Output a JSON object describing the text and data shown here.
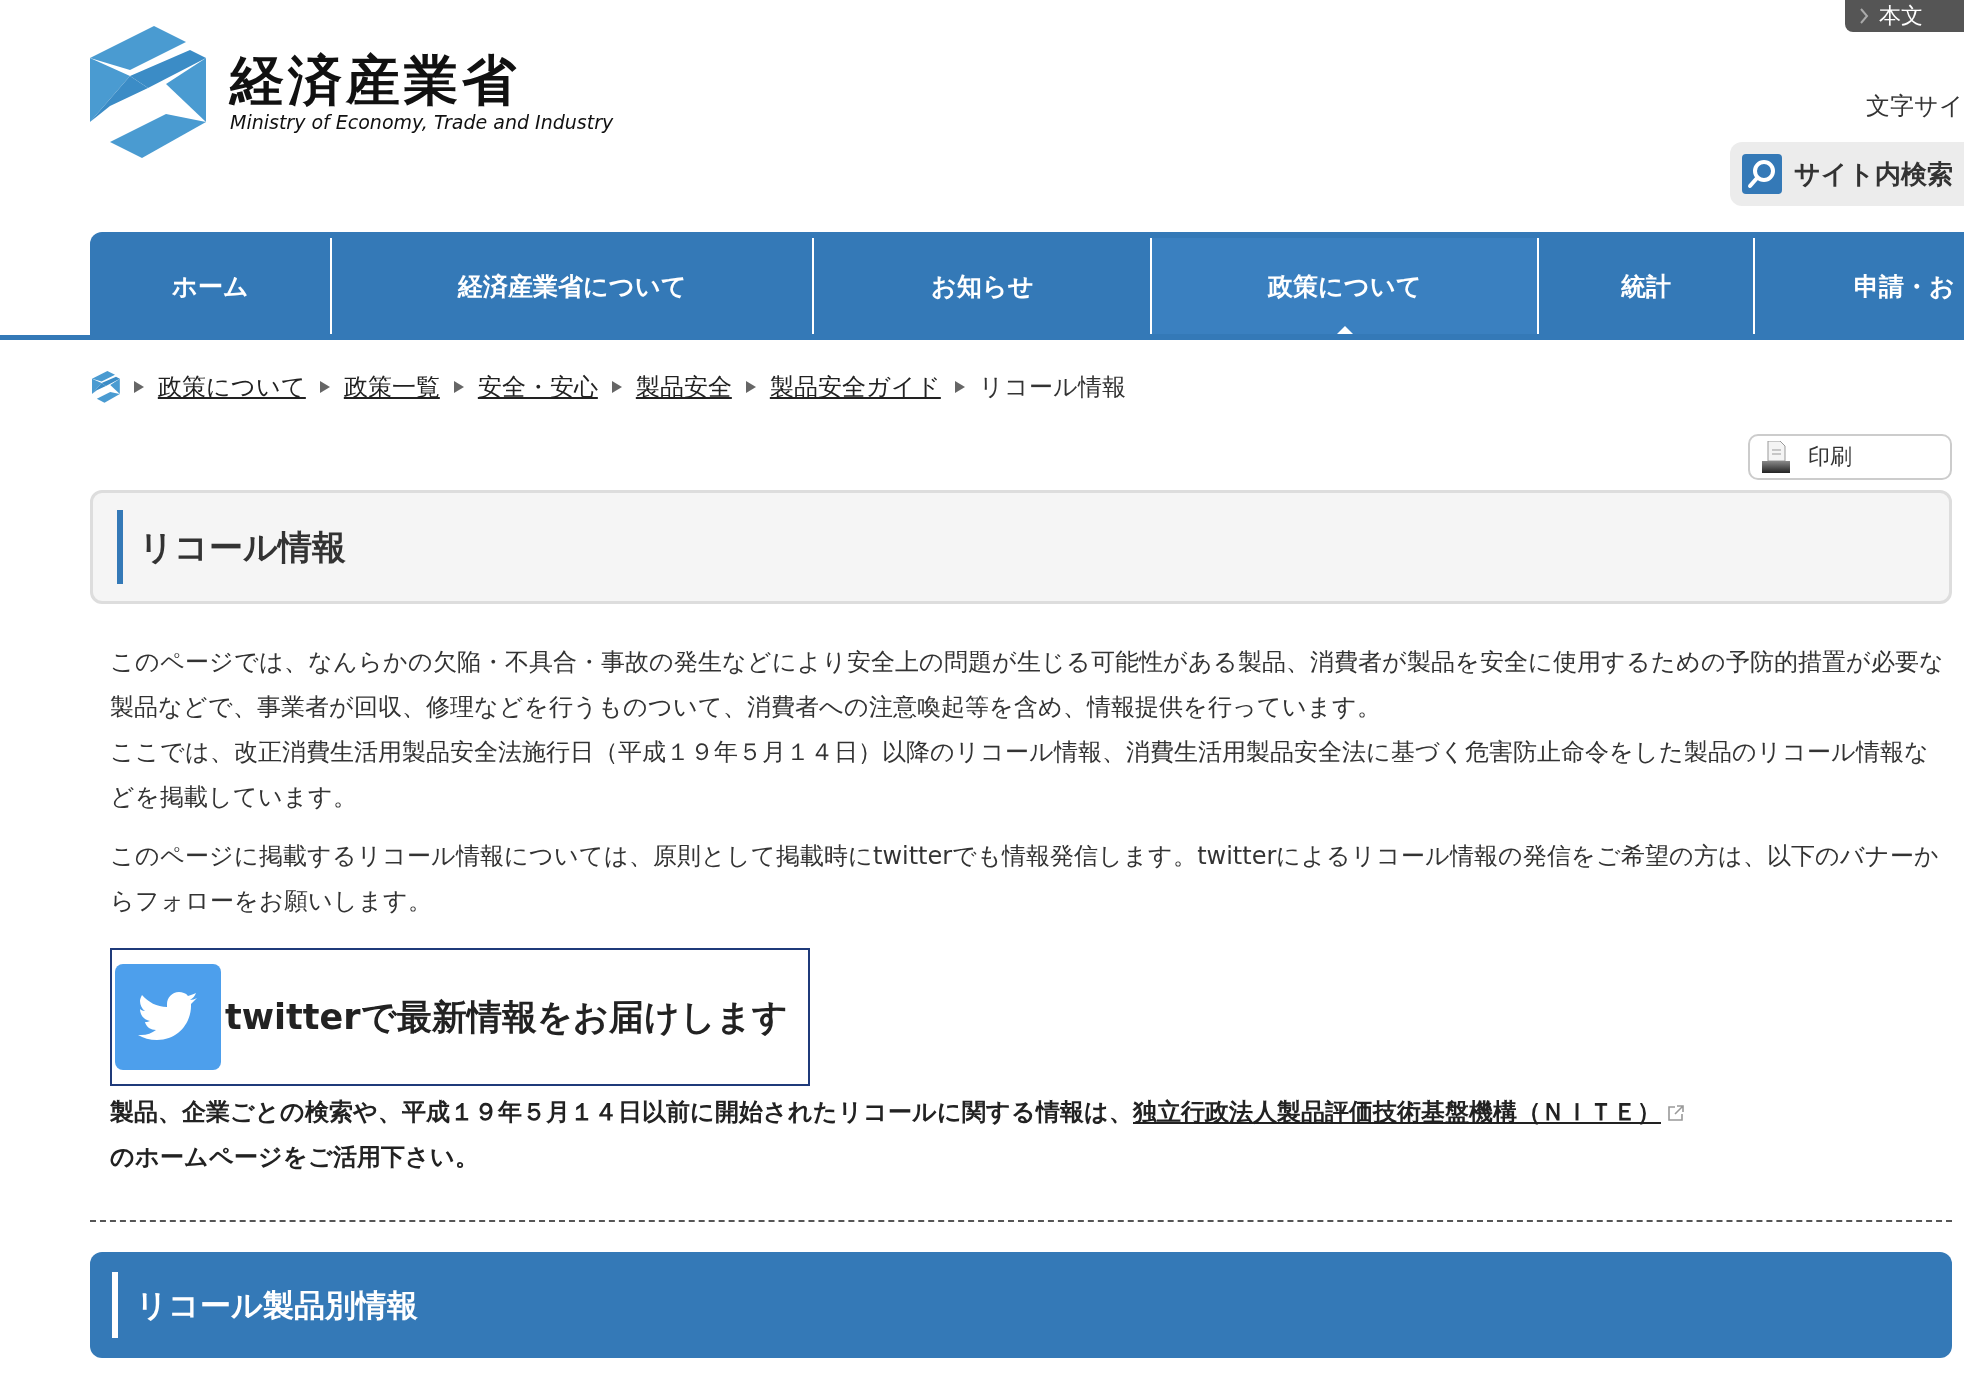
{
  "header": {
    "logo_title": "経済産業省",
    "logo_subtitle": "Ministry of Economy, Trade and Industry",
    "skip_link": "本文",
    "font_size_label": "文字サイ",
    "search_button": "サイト内検索"
  },
  "nav": [
    {
      "label": "ホーム",
      "selected": false
    },
    {
      "label": "経済産業省について",
      "selected": false
    },
    {
      "label": "お知らせ",
      "selected": false
    },
    {
      "label": "政策について",
      "selected": true
    },
    {
      "label": "統計",
      "selected": false
    },
    {
      "label": "申請・お",
      "selected": false
    }
  ],
  "breadcrumb": [
    {
      "label": "政策について",
      "kind": "link"
    },
    {
      "label": "政策一覧",
      "kind": "link"
    },
    {
      "label": "安全・安心",
      "kind": "link"
    },
    {
      "label": "製品安全",
      "kind": "link"
    },
    {
      "label": "製品安全ガイド",
      "kind": "link"
    },
    {
      "label": "リコール情報",
      "kind": "current"
    }
  ],
  "print_button": "印刷",
  "page_title": "リコール情報",
  "paragraphs": [
    [
      "このページでは、なんらかの欠陥・不具合・事故の発生などにより安全上の問題が生じる可能性がある製品、消費者が製品を安全に使用するための予防的措置が必要な製品などで、事業者が回収、修理などを行うものついて、消費者への注意喚起等を含め、情報提供を行っています。",
      "ここでは、改正消費生活用製品安全法施行日（平成１９年５月１４日）以降のリコール情報、消費生活用製品安全法に基づく危害防止命令をした製品のリコール情報などを掲載しています。"
    ],
    [
      "このページに掲載するリコール情報については、原則として掲載時にtwitterでも情報発信します。twitterによるリコール情報の発信をご希望の方は、以下のバナーからフォローをお願いします。"
    ]
  ],
  "twitter_banner": "twitterで最新情報をお届けします",
  "nite_notice": {
    "before": "製品、企業ごとの検索や、平成１９年５月１４日以前に開始されたリコールに関する情報は、",
    "link": "独立行政法人製品評価技術基盤機構（ＮＩＴＥ）",
    "after": "のホームページをご活用下さい。"
  },
  "section_heading": "リコール製品別情報"
}
